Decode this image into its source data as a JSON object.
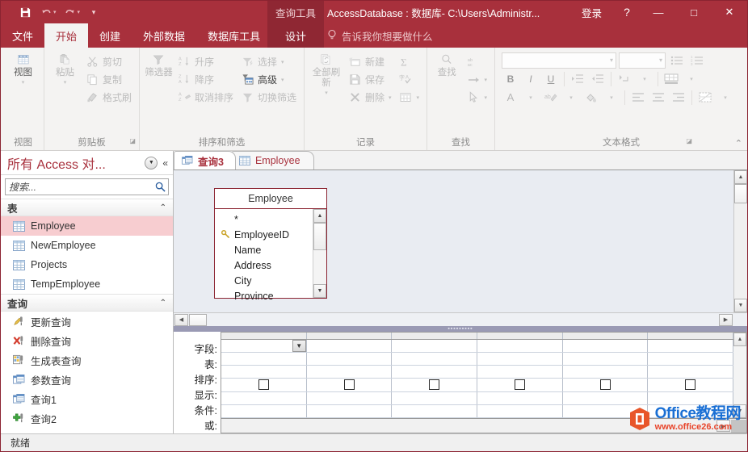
{
  "titlebar": {
    "save_icon": "save-icon",
    "undo_icon": "undo-icon",
    "redo_icon": "redo-icon",
    "customize_icon": "customize-qat-icon",
    "contextual_tab_title": "查询工具",
    "window_title": "AccessDatabase : 数据库- C:\\Users\\Administr...",
    "signin": "登录",
    "help": "?",
    "minimize": "—",
    "maximize": "□",
    "close": "✕"
  },
  "ribbon": {
    "tabs": [
      {
        "label": "文件",
        "active": false
      },
      {
        "label": "开始",
        "active": true
      },
      {
        "label": "创建",
        "active": false
      },
      {
        "label": "外部数据",
        "active": false
      },
      {
        "label": "数据库工具",
        "active": false
      }
    ],
    "contextual_tab": "设计",
    "tellme_placeholder": "告诉我你想要做什么",
    "collapse_icon": "chevron-up-icon",
    "groups": [
      {
        "name": "视图",
        "label": "视图",
        "big_button": {
          "label": "视图",
          "icon": "table-view-icon"
        }
      },
      {
        "name": "剪贴板",
        "label": "剪贴板",
        "big_button": {
          "label": "粘贴",
          "icon": "paste-icon"
        },
        "items": [
          {
            "label": "剪切",
            "icon": "scissors-icon"
          },
          {
            "label": "复制",
            "icon": "copy-icon"
          },
          {
            "label": "格式刷",
            "icon": "format-painter-icon"
          }
        ],
        "dialog_launcher": true
      },
      {
        "name": "排序和筛选",
        "label": "排序和筛选",
        "big_button": {
          "label": "筛选器",
          "icon": "filter-funnel-icon"
        },
        "items": [
          {
            "label": "升序",
            "icon": "sort-ascending-icon"
          },
          {
            "label": "降序",
            "icon": "sort-descending-icon"
          },
          {
            "label": "取消排序",
            "icon": "clear-sort-icon"
          },
          {
            "label": "选择",
            "icon": "selection-filter-icon",
            "caret": true
          },
          {
            "label": "高级",
            "icon": "advanced-filter-icon",
            "caret": true,
            "enabled": true
          },
          {
            "label": "切换筛选",
            "icon": "toggle-filter-icon"
          }
        ]
      },
      {
        "name": "记录",
        "label": "记录",
        "big_button": {
          "label": "全部刷新",
          "icon": "refresh-all-icon"
        },
        "items": [
          {
            "label": "新建",
            "icon": "new-record-icon"
          },
          {
            "label": "保存",
            "icon": "save-record-icon"
          },
          {
            "label": "删除",
            "icon": "delete-record-icon",
            "caret": true
          },
          {
            "label": "",
            "icon": "totals-sigma-icon"
          },
          {
            "label": "",
            "icon": "spelling-check-icon"
          },
          {
            "label": "",
            "icon": "more-records-icon",
            "caret": true
          }
        ]
      },
      {
        "name": "查找",
        "label": "查找",
        "big_button": {
          "label": "查找",
          "icon": "magnifier-icon"
        },
        "items": [
          {
            "label": "",
            "icon": "replace-abac-icon"
          },
          {
            "label": "",
            "icon": "goto-arrow-icon",
            "caret": true
          },
          {
            "label": "",
            "icon": "select-cursor-icon",
            "caret": true
          }
        ]
      },
      {
        "name": "文本格式",
        "label": "文本格式",
        "font_name_value": "",
        "font_size_value": "",
        "buttons": [
          "bold-icon",
          "italic-icon",
          "underline-icon",
          "indent-increase-icon",
          "indent-decrease-icon",
          "bullets-icon",
          "numbering-icon",
          "text-direction-icon",
          "gridlines-icon",
          "font-color-icon",
          "text-highlight-icon",
          "fill-color-icon",
          "align-left-icon",
          "align-center-icon",
          "align-right-icon",
          "alternate-row-color-icon"
        ],
        "bold": "B",
        "italic": "I",
        "underline": "U",
        "font_color": "A",
        "highlight": "ab",
        "dialog_launcher": true
      }
    ]
  },
  "navpane": {
    "title": "所有 Access 对...",
    "dropdown_icon": "chevron-down-circle-icon",
    "collapse_icon": "double-chevron-left-icon",
    "search_placeholder": "搜索...",
    "search_value": "",
    "search_icon": "search-icon",
    "groups": [
      {
        "label": "表",
        "collapse_icon": "chevron-up-icon",
        "items": [
          {
            "label": "Employee",
            "icon": "table-icon",
            "selected": true
          },
          {
            "label": "NewEmployee",
            "icon": "table-icon",
            "selected": false
          },
          {
            "label": "Projects",
            "icon": "table-icon",
            "selected": false
          },
          {
            "label": "TempEmployee",
            "icon": "table-icon",
            "selected": false
          }
        ]
      },
      {
        "label": "查询",
        "collapse_icon": "chevron-up-icon",
        "items": [
          {
            "label": "更新查询",
            "icon": "update-query-icon",
            "selected": false
          },
          {
            "label": "删除查询",
            "icon": "delete-query-icon",
            "selected": false
          },
          {
            "label": "生成表查询",
            "icon": "maketable-query-icon",
            "selected": false
          },
          {
            "label": "参数查询",
            "icon": "select-query-icon",
            "selected": false
          },
          {
            "label": "查询1",
            "icon": "select-query-icon",
            "selected": false
          },
          {
            "label": "查询2",
            "icon": "append-query-icon",
            "selected": false
          }
        ]
      }
    ]
  },
  "document": {
    "tabs": [
      {
        "label": "查询3",
        "icon": "query-icon",
        "active": true
      },
      {
        "label": "Employee",
        "icon": "table-icon",
        "active": false
      }
    ],
    "close_icon": "close-icon",
    "table_box": {
      "title": "Employee",
      "fields": [
        {
          "name": "*",
          "key": false
        },
        {
          "name": "EmployeeID",
          "key": true
        },
        {
          "name": "Name",
          "key": false
        },
        {
          "name": "Address",
          "key": false
        },
        {
          "name": "City",
          "key": false
        },
        {
          "name": "Province",
          "key": false
        }
      ],
      "scroll_up_icon": "scroll-up-icon",
      "scroll_down_icon": "scroll-down-icon"
    },
    "grid": {
      "row_labels": [
        "字段:",
        "表:",
        "排序:",
        "显示:",
        "条件:",
        "或:"
      ],
      "column_count": 6,
      "show_checked": [
        false,
        false,
        false,
        false,
        false,
        false
      ],
      "field_dropdown_icon": "chevron-down-icon"
    },
    "splitter_icon": "splitter-grip"
  },
  "statusbar": {
    "text": "就绪"
  },
  "watermark": {
    "brand": "Office教程网",
    "url": "www.office26.com",
    "logo_icon": "office-logo-icon"
  }
}
